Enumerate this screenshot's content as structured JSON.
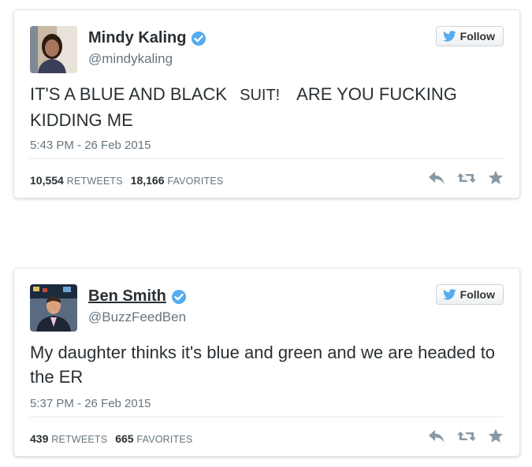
{
  "tweets": [
    {
      "display_name": "Mindy Kaling",
      "handle": "@mindykaling",
      "follow_label": "Follow",
      "text_before": "IT'S A BLUE AND BLACK",
      "text_patch": "SUIT!",
      "text_after": "ARE YOU FUCKING KIDDING ME",
      "timestamp": "5:43 PM - 26 Feb 2015",
      "retweets_count": "10,554",
      "retweets_label": "RETWEETS",
      "favorites_count": "18,166",
      "favorites_label": "FAVORITES"
    },
    {
      "display_name": "Ben Smith",
      "handle": "@BuzzFeedBen",
      "follow_label": "Follow",
      "text": "My daughter thinks it's blue and green and we are headed to the ER",
      "timestamp": "5:37 PM - 26 Feb 2015",
      "retweets_count": "439",
      "retweets_label": "RETWEETS",
      "favorites_count": "665",
      "favorites_label": "FAVORITES"
    }
  ],
  "colors": {
    "verified": "#55acee",
    "bird": "#55acee",
    "action_icons": "#8899a6",
    "text_primary": "#292f33",
    "text_secondary": "#66757f"
  },
  "icons": [
    "verified-badge-icon",
    "twitter-bird-icon",
    "reply-icon",
    "retweet-icon",
    "favorite-star-icon"
  ]
}
